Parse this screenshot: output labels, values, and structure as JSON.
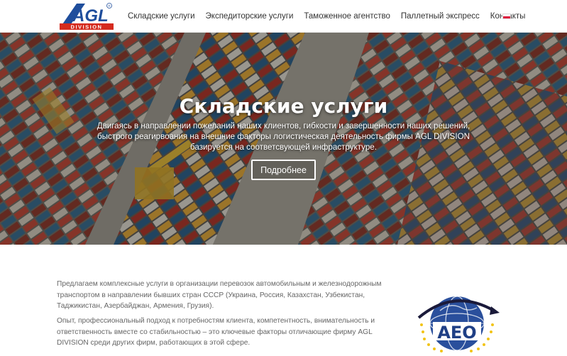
{
  "header": {
    "logo": {
      "top_text": "AGL",
      "bottom_text": "DIVISION",
      "registered": "®"
    },
    "nav": [
      {
        "label": "Складские услуги"
      },
      {
        "label": "Экспедиторские услуги"
      },
      {
        "label": "Таможенное агентство"
      },
      {
        "label": "Паллетный экспресс"
      },
      {
        "label": "Контакты"
      }
    ],
    "language_flag": "poland-flag-icon"
  },
  "hero": {
    "title": "Складские услуги",
    "text": "Двигаясь в направлении пожеланий наших клиентов, гибкости и завершенности наших решений, быстрого реагирвоания на внешние факторы логистическая деятельность фирмы AGL DIVISION базируется на соответсвующей инфраструктуре.",
    "button_label": "Подробнее"
  },
  "content": {
    "paragraph1": "Предлагаем комплексные услуги в организации перевозок автомобильным и железнодорожным транспортом в направлении бывших стран СССР (Украина, Россия, Казахстан, Узбекистан, Таджикистан, Азербайджан, Армения, Грузия).",
    "paragraph2": "Опыт, профессиональный подход к потребностям клиента, компетентность, внимательность и ответственность вместе со стабильностью – это ключевые факторы отличающие фирму AGL DIVISION среди других фирм, работающих в этой сфере.",
    "aeo_logo_text": "AEO"
  },
  "colors": {
    "brand_blue": "#1f4e9c",
    "brand_red": "#d52b1e",
    "text_gray": "#666666"
  }
}
